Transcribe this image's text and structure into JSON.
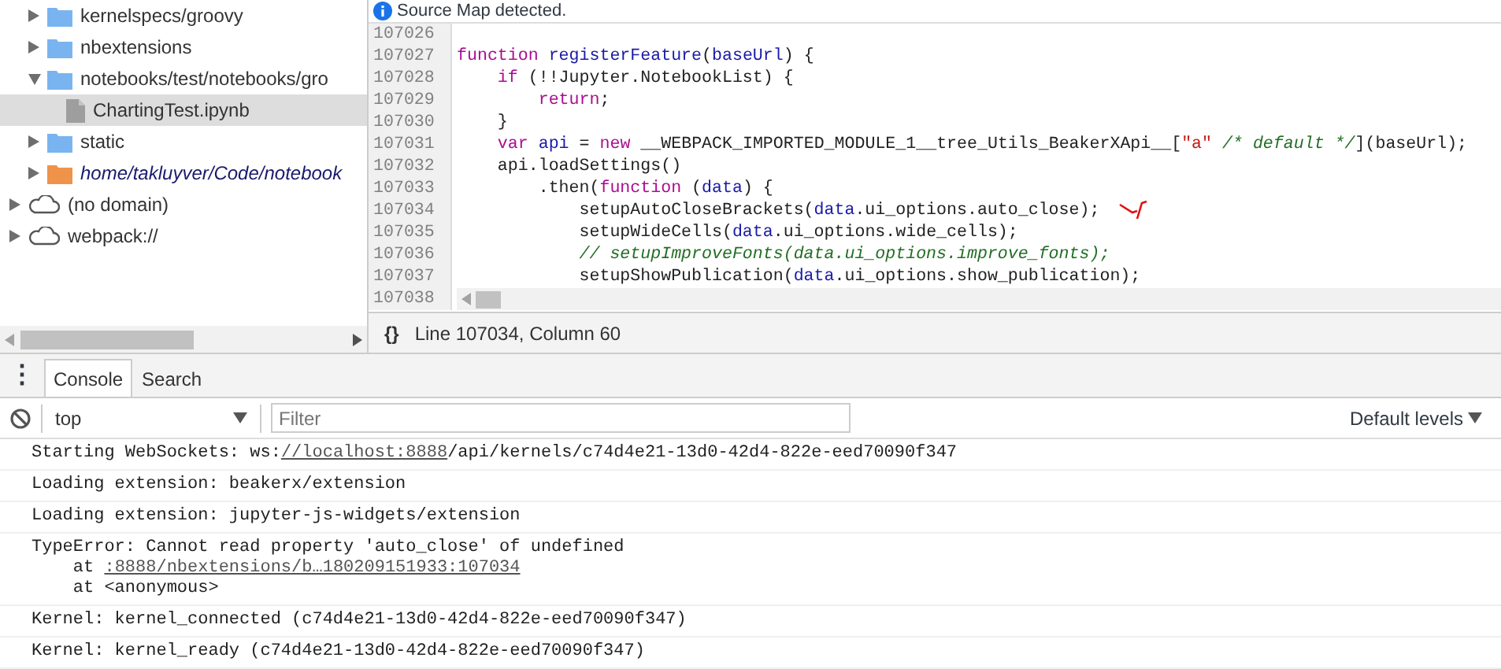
{
  "navigator": {
    "continued_items": [
      {
        "label": "kernelspecs/groovy",
        "kind": "folder",
        "expanded": false,
        "selected": false,
        "italic": false
      },
      {
        "label": "nbextensions",
        "kind": "folder",
        "expanded": false,
        "selected": false,
        "italic": false
      },
      {
        "label": "notebooks/test/notebooks/gro",
        "kind": "folder",
        "expanded": true,
        "selected": false,
        "italic": false,
        "children": [
          {
            "label": "ChartingTest.ipynb",
            "kind": "file",
            "selected": true,
            "italic": false
          }
        ]
      },
      {
        "label": "static",
        "kind": "folder",
        "expanded": false,
        "selected": false,
        "italic": false
      },
      {
        "label": "home/takluyver/Code/notebook",
        "kind": "folder-orange",
        "expanded": false,
        "selected": false,
        "italic": true
      }
    ],
    "items": [
      {
        "label": "(no domain)",
        "kind": "cloud",
        "expanded": false,
        "selected": false,
        "italic": false
      },
      {
        "label": "webpack://",
        "kind": "cloud",
        "expanded": false,
        "selected": false,
        "italic": false
      }
    ]
  },
  "banner": {
    "text": "Source Map detected."
  },
  "editor": {
    "lines": [
      {
        "number": "107026"
      },
      {
        "number": "107027",
        "tokens": [
          {
            "kind": "keyword",
            "text": "function"
          },
          {
            "kind": "def",
            "text": " registerFeature"
          },
          {
            "kind": "plain",
            "text": "("
          },
          {
            "kind": "def",
            "text": "baseUrl"
          },
          {
            "kind": "plain",
            "text": ") {"
          }
        ]
      },
      {
        "number": "107028",
        "tokens": [
          {
            "kind": "keyword",
            "text": "    if"
          },
          {
            "kind": "plain",
            "text": " (!!Jupyter.NotebookList) {"
          }
        ]
      },
      {
        "number": "107029",
        "tokens": [
          {
            "kind": "keyword",
            "text": "        return"
          },
          {
            "kind": "plain",
            "text": ";"
          }
        ]
      },
      {
        "number": "107030",
        "tokens": [
          {
            "kind": "plain",
            "text": "    }"
          }
        ]
      },
      {
        "number": "107031",
        "tokens": [
          {
            "kind": "keyword",
            "text": "    var"
          },
          {
            "kind": "def",
            "text": " api"
          },
          {
            "kind": "plain",
            "text": " = "
          },
          {
            "kind": "keyword",
            "text": "new"
          },
          {
            "kind": "plain",
            "text": " __WEBPACK_IMPORTED_MODULE_1__tree_Utils_BeakerXApi__["
          },
          {
            "kind": "string",
            "text": "\"a\""
          },
          {
            "kind": "comment",
            "text": " /* default */"
          },
          {
            "kind": "plain",
            "text": "](baseUrl);"
          }
        ]
      },
      {
        "number": "107032",
        "tokens": [
          {
            "kind": "plain",
            "text": "    api.loadSettings()"
          }
        ]
      },
      {
        "number": "107033",
        "tokens": [
          {
            "kind": "plain",
            "text": "        .then("
          },
          {
            "kind": "keyword",
            "text": "function"
          },
          {
            "kind": "plain",
            "text": " ("
          },
          {
            "kind": "def",
            "text": "data"
          },
          {
            "kind": "plain",
            "text": ") {"
          }
        ]
      },
      {
        "number": "107034",
        "tokens": [
          {
            "kind": "plain",
            "text": "            setupAutoCloseBrackets("
          },
          {
            "kind": "def",
            "text": "data"
          },
          {
            "kind": "plain",
            "text": ".ui_options.auto_close);"
          }
        ],
        "annotated": true
      },
      {
        "number": "107035",
        "tokens": [
          {
            "kind": "plain",
            "text": "            setupWideCells("
          },
          {
            "kind": "def",
            "text": "data"
          },
          {
            "kind": "plain",
            "text": ".ui_options.wide_cells);"
          }
        ]
      },
      {
        "number": "107036",
        "tokens": [
          {
            "kind": "comment",
            "text": "            // setupImproveFonts(data.ui_options.improve_fonts);"
          }
        ]
      },
      {
        "number": "107037",
        "tokens": [
          {
            "kind": "plain",
            "text": "            setupShowPublication("
          },
          {
            "kind": "def",
            "text": "data"
          },
          {
            "kind": "plain",
            "text": ".ui_options.show_publication);"
          }
        ]
      },
      {
        "number": "107038"
      }
    ],
    "status": {
      "format_icon": "{}",
      "position": "Line 107034, Column 60"
    }
  },
  "drawer": {
    "menu_icon": "⋮",
    "tabs": [
      {
        "label": "Console",
        "selected": true
      },
      {
        "label": "Search",
        "selected": false
      }
    ]
  },
  "console_toolbar": {
    "context": "top",
    "filter": {
      "placeholder": "Filter"
    },
    "levels": "Default levels"
  },
  "messages": [
    {
      "lines": [
        [
          {
            "text": "Starting WebSockets: ws:",
            "link": false
          },
          {
            "text": "//localhost:8888",
            "link": true
          },
          {
            "text": "/api/kernels/c74d4e21-13d0-42d4-822e-eed70090f347",
            "link": false
          }
        ]
      ]
    },
    {
      "lines": [
        [
          {
            "text": "Loading extension: beakerx/extension",
            "link": false
          }
        ]
      ]
    },
    {
      "lines": [
        [
          {
            "text": "Loading extension: jupyter-js-widgets/extension",
            "link": false
          }
        ]
      ]
    },
    {
      "lines": [
        [
          {
            "text": "TypeError: Cannot read property 'auto_close' of undefined",
            "link": false
          }
        ],
        [
          {
            "text": "    at ",
            "link": false
          },
          {
            "text": ":8888/nbextensions/b…180209151933:107034",
            "link": true
          }
        ],
        [
          {
            "text": "    at <anonymous>",
            "link": false
          }
        ]
      ]
    },
    {
      "lines": [
        [
          {
            "text": "Kernel: kernel_connected (c74d4e21-13d0-42d4-822e-eed70090f347)",
            "link": false
          }
        ]
      ]
    },
    {
      "lines": [
        [
          {
            "text": "Kernel: kernel_ready (c74d4e21-13d0-42d4-822e-eed70090f347)",
            "link": false
          }
        ]
      ]
    }
  ]
}
